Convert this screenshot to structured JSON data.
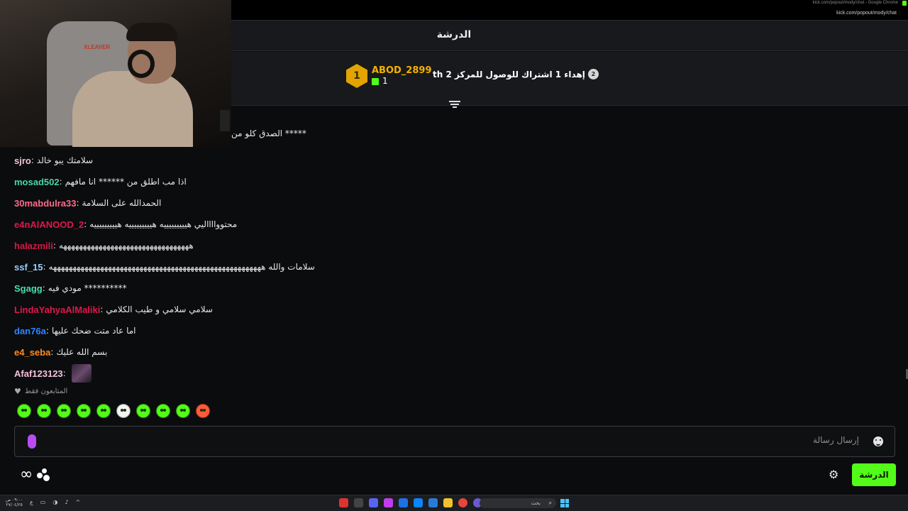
{
  "browser": {
    "window_title": "kick.com/popout/mody/chat - Google Chrome",
    "url": "kick.com/popout/mody/chat"
  },
  "header": {
    "title": "الدرشة"
  },
  "pinned": {
    "leaderboard": {
      "rank": "1",
      "username": "ABOD_2899",
      "gift_count": "1"
    },
    "goal_badge": "2",
    "goal_text": "إهداء 1 اشتراك للوصول للمركز 2 th"
  },
  "cut_message": "الصدق كلو من *****",
  "messages": [
    {
      "user": "sjro",
      "color": "#f4c2d9",
      "text": "سلامتك يبو خالد"
    },
    {
      "user": "mosad502",
      "color": "#4ad6a7",
      "text": "اذا مب اطلق من ****** انا مافهم"
    },
    {
      "user": "30mabdulra33",
      "color": "#ff6b8b",
      "text": "الحمدالله على السلامة"
    },
    {
      "user": "e4nAlANOOD_2",
      "color": "#e0184b",
      "text": "محتووااااليي هيييييييييه هيييييييييه هيييييييييه"
    },
    {
      "user": "halazmili",
      "color": "#d21a45",
      "text": "هههههههههههههههههههههههههههههههههه"
    },
    {
      "user": "ssf_15",
      "color": "#9ad0ff",
      "text": "سلامات والله ههههههههههههههههههههههههههههههههههههههههههههههههههههههه"
    },
    {
      "user": "Sgagg",
      "color": "#45e0ad",
      "text": "مودي فيه **********"
    },
    {
      "user": "LindaYahyaAlMaliki",
      "color": "#e0184b",
      "text": "سلامي سلامي و طيب الكلامي"
    },
    {
      "user": "dan76a",
      "color": "#2e86ff",
      "text": "اما عاد متت ضحك عليها"
    },
    {
      "user": "e4_seba",
      "color": "#ff8c1a",
      "text": "بسم الله عليك"
    },
    {
      "user": "Afaf123123",
      "color": "#f4c2d9",
      "text": ""
    }
  ],
  "followers_only": "المتابعون فقط",
  "composer": {
    "placeholder": "إرسال رسالة"
  },
  "footer": {
    "chat_button": "الدرشة"
  },
  "taskbar": {
    "time": "٠٩:٠٠ ص",
    "date": "٢٧/٠٤/٢٥",
    "search_placeholder": "بحث"
  }
}
